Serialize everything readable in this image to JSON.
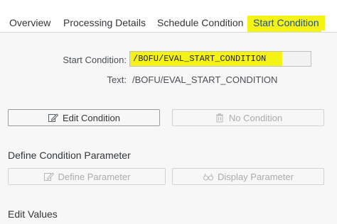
{
  "tabs": [
    {
      "label": "Overview",
      "selected": false
    },
    {
      "label": "Processing Details",
      "selected": false
    },
    {
      "label": "Schedule Condition",
      "selected": false
    },
    {
      "label": "Start Condition",
      "selected": true
    }
  ],
  "form": {
    "start_condition_label": "Start Condition:",
    "start_condition_value": "/BOFU/EVAL_START_CONDITION",
    "text_label": "Text:",
    "text_value": "/BOFU/EVAL_START_CONDITION"
  },
  "buttons": {
    "edit_condition": {
      "label": "Edit Condition",
      "icon": "edit-icon",
      "enabled": true
    },
    "no_condition": {
      "label": "No Condition",
      "icon": "trash-icon",
      "enabled": false
    },
    "define_parameter": {
      "label": "Define Parameter",
      "icon": "edit-icon",
      "enabled": false
    },
    "display_parameter": {
      "label": "Display Parameter",
      "icon": "glasses-icon",
      "enabled": false
    }
  },
  "sections": {
    "define_condition_parameter": "Define Condition Parameter",
    "edit_values": "Edit Values"
  },
  "colors": {
    "highlight": "#f5f216",
    "selected_tab_text": "#1a4fa0",
    "content_background": "#f7f7f7"
  }
}
